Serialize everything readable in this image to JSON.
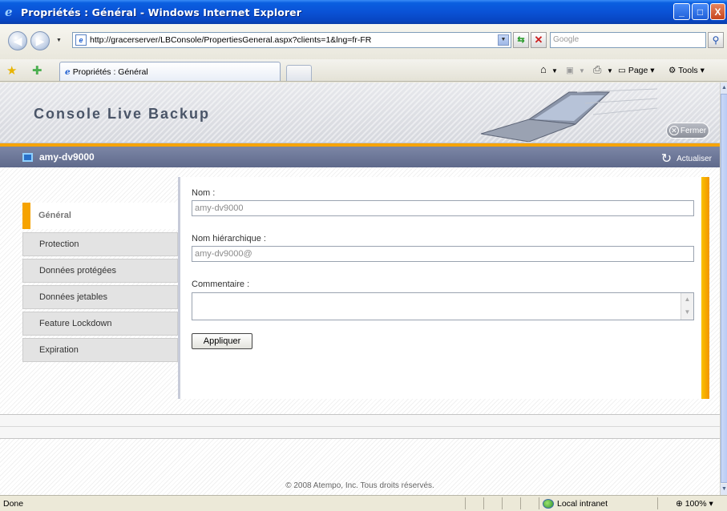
{
  "window": {
    "title": "Propriétés : Général - Windows Internet Explorer",
    "minimize_glyph": "_",
    "maximize_glyph": "□",
    "close_glyph": "X"
  },
  "addressbar": {
    "url": "http://gracerserver/LBConsole/PropertiesGeneral.aspx?clients=1&lng=fr-FR",
    "search_placeholder": "Google"
  },
  "tabs": [
    {
      "label": "Propriétés : Général"
    }
  ],
  "commandbar": {
    "page_label": "Page",
    "tools_label": "Tools"
  },
  "app": {
    "brand": "Console Live Backup",
    "close_label": "Fermer",
    "hostname": "amy-dv9000",
    "refresh_label": "Actualiser"
  },
  "menu": {
    "items": [
      {
        "label": "Général",
        "active": true
      },
      {
        "label": "Protection",
        "active": false
      },
      {
        "label": "Données protégées",
        "active": false
      },
      {
        "label": "Données jetables",
        "active": false
      },
      {
        "label": "Feature Lockdown",
        "active": false
      },
      {
        "label": "Expiration",
        "active": false
      }
    ]
  },
  "form": {
    "name_label": "Nom :",
    "name_value": "amy-dv9000",
    "hier_label": "Nom hiérarchique :",
    "hier_value": "amy-dv9000@",
    "comment_label": "Commentaire :",
    "comment_value": "",
    "apply_label": "Appliquer"
  },
  "footer": {
    "copyright": "© 2008 Atempo, Inc. Tous droits réservés."
  },
  "statusbar": {
    "status": "Done",
    "zone": "Local intranet",
    "zoom": "100%"
  },
  "colors": {
    "accent_orange": "#f6a300",
    "hostbar": "#6b7596",
    "titlebar_blue": "#0a52d6"
  }
}
